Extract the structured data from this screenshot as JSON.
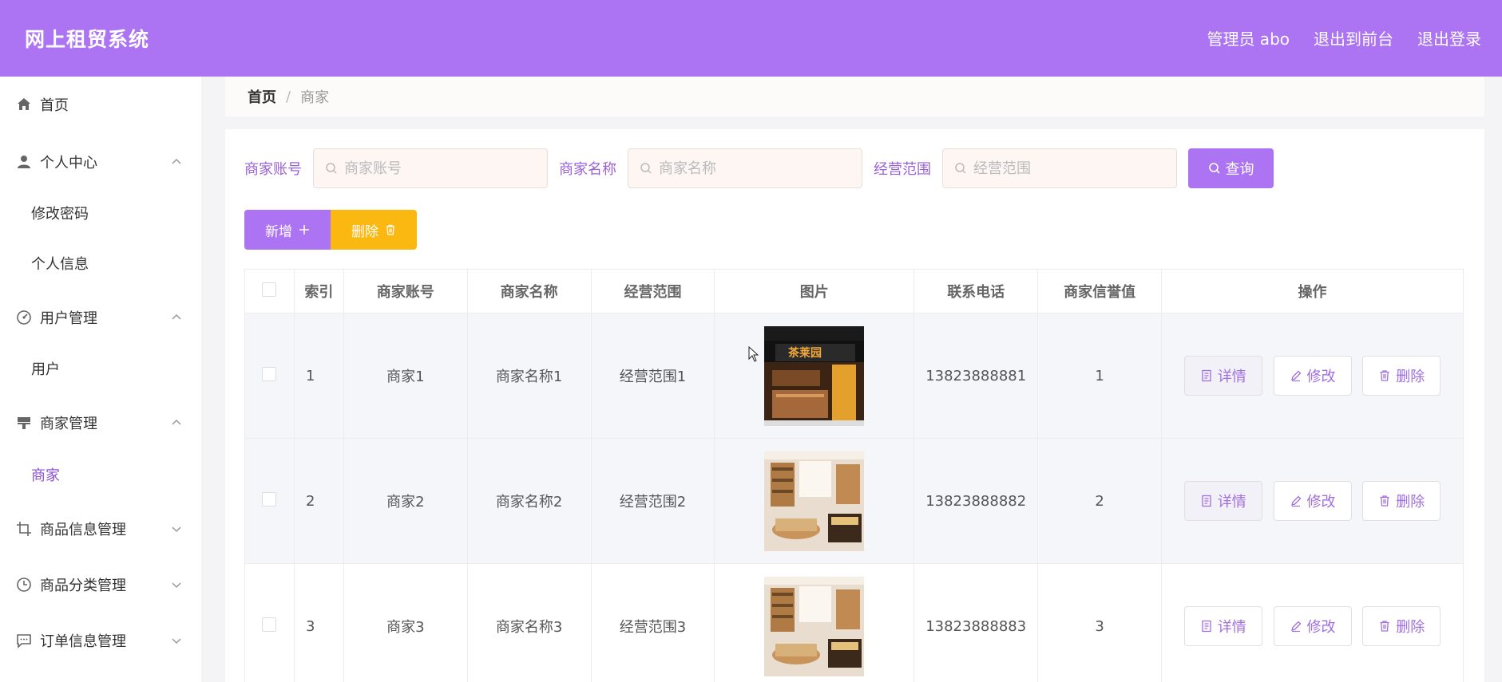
{
  "header": {
    "brand": "网上租贸系统",
    "admin_label": "管理员 abo",
    "to_front_label": "退出到前台",
    "logout_label": "退出登录"
  },
  "sidebar": {
    "items": [
      {
        "label": "首页",
        "icon": "home-icon"
      },
      {
        "label": "个人中心",
        "icon": "user-icon",
        "expanded": true
      },
      {
        "label": "修改密码",
        "sub": true
      },
      {
        "label": "个人信息",
        "sub": true
      },
      {
        "label": "用户管理",
        "icon": "user-manage-icon",
        "expanded": true
      },
      {
        "label": "用户",
        "sub": true
      },
      {
        "label": "商家管理",
        "icon": "store-icon",
        "expanded": true
      },
      {
        "label": "商家",
        "sub": true,
        "active": true
      },
      {
        "label": "商品信息管理",
        "icon": "crop-icon",
        "expanded": false
      },
      {
        "label": "商品分类管理",
        "icon": "clock-icon",
        "expanded": false
      },
      {
        "label": "订单信息管理",
        "icon": "message-icon",
        "expanded": false
      }
    ]
  },
  "breadcrumb": {
    "home": "首页",
    "separator": "/",
    "current": "商家"
  },
  "search": {
    "account_label": "商家账号",
    "account_placeholder": "商家账号",
    "name_label": "商家名称",
    "name_placeholder": "商家名称",
    "scope_label": "经营范围",
    "scope_placeholder": "经营范围",
    "query_label": "查询"
  },
  "actions": {
    "add_label": "新增",
    "delete_label": "删除"
  },
  "table": {
    "headers": [
      "",
      "索引",
      "商家账号",
      "商家名称",
      "经营范围",
      "图片",
      "联系电话",
      "商家信誉值",
      "操作"
    ],
    "rows": [
      {
        "index": "1",
        "account": "商家1",
        "name": "商家名称1",
        "scope": "经营范围1",
        "phone": "13823888881",
        "credit": "1",
        "image": "tea-shop-storefront"
      },
      {
        "index": "2",
        "account": "商家2",
        "name": "商家名称2",
        "scope": "经营范围2",
        "phone": "13823888882",
        "credit": "2",
        "image": "store-interior"
      },
      {
        "index": "3",
        "account": "商家3",
        "name": "商家名称3",
        "scope": "经营范围3",
        "phone": "13823888883",
        "credit": "3",
        "image": "store-interior"
      }
    ],
    "op_detail": "详情",
    "op_edit": "修改",
    "op_delete": "删除"
  },
  "colors": {
    "primary": "#ac74f2",
    "warning": "#fbb811",
    "active_text": "#8d4fd9"
  }
}
